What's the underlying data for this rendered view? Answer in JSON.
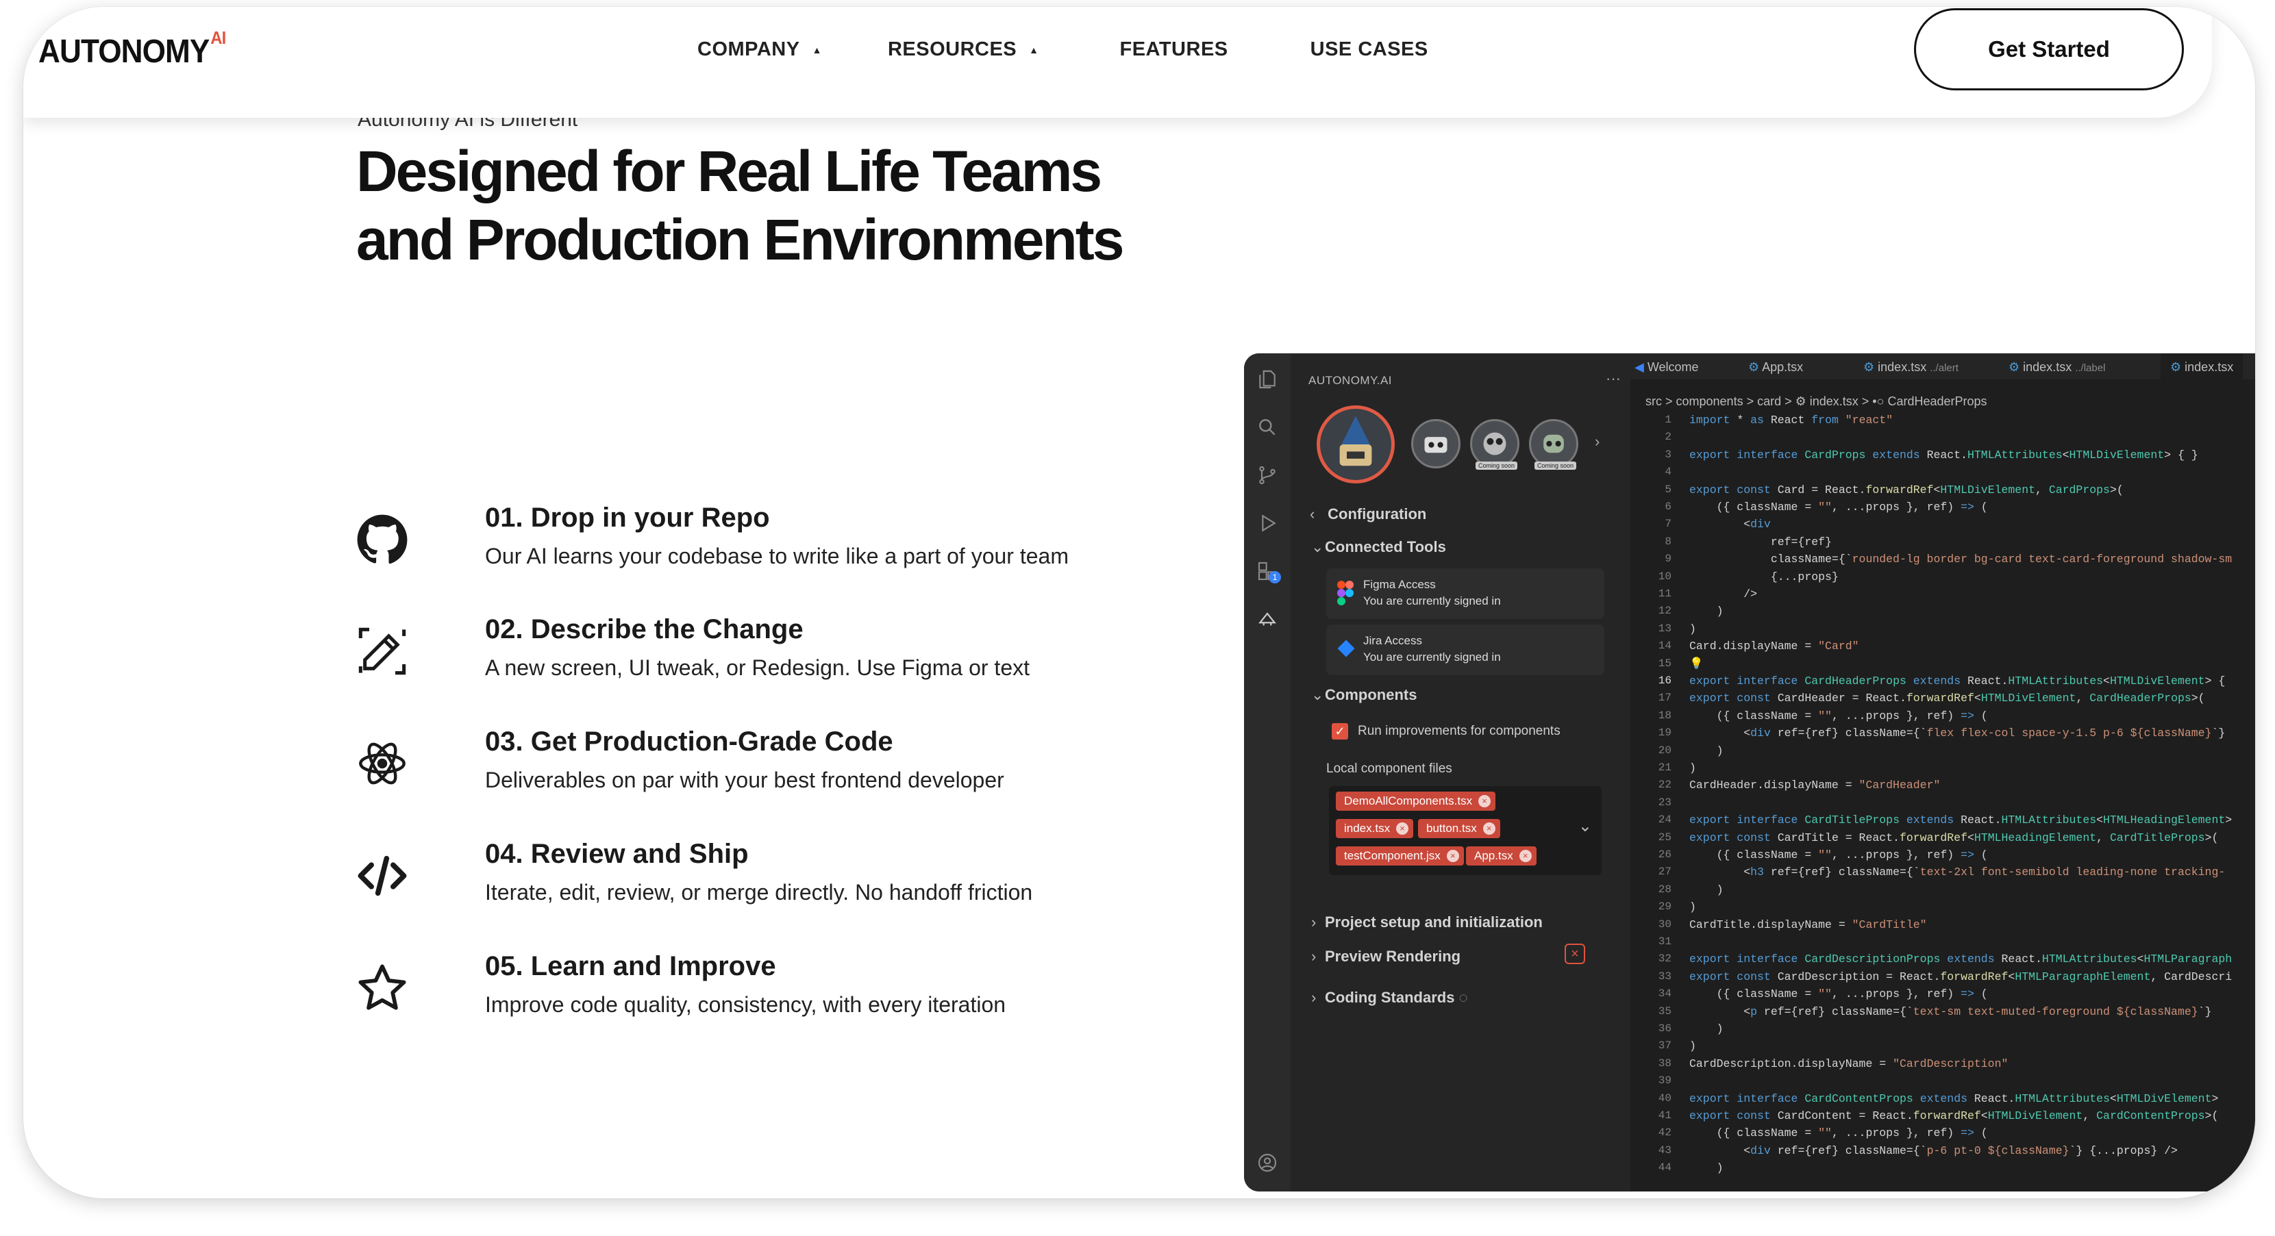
{
  "nav": {
    "logo_text": "AUTONOMY",
    "logo_sup": "AI",
    "items": [
      {
        "label": "COMPANY",
        "has_caret": true
      },
      {
        "label": "RESOURCES",
        "has_caret": true
      },
      {
        "label": "FEATURES",
        "has_caret": false
      },
      {
        "label": "USE CASES",
        "has_caret": false
      }
    ],
    "cta_label": "Get Started"
  },
  "hero": {
    "eyebrow": "Autonomy AI is Different",
    "headline_line1": "Designed for Real Life Teams",
    "headline_line2": "and Production Environments"
  },
  "steps": [
    {
      "title": "01. Drop in your Repo",
      "desc": "Our AI learns your codebase to write like a part of your team",
      "icon": "github-icon"
    },
    {
      "title": "02. Describe the Change",
      "desc": "A new screen, UI tweak, or Redesign. Use Figma or text",
      "icon": "pencil-icon"
    },
    {
      "title": "03. Get Production-Grade Code",
      "desc": "Deliverables on par with your best frontend developer",
      "icon": "atom-icon"
    },
    {
      "title": "04. Review and Ship",
      "desc": "Iterate, edit, review, or merge directly. No handoff friction",
      "icon": "code-icon"
    },
    {
      "title": "05. Learn and Improve",
      "desc": "Improve code quality, consistency, with every iteration",
      "icon": "star-icon"
    }
  ],
  "ide": {
    "panel_title": "AUTONOMY.AI",
    "avatar_badges": [
      "Coming soon",
      "Coming soon"
    ],
    "activity_badge": "1",
    "configuration": "Configuration",
    "connected_tools": "Connected Tools",
    "tools": [
      {
        "name": "Figma Access",
        "status": "You are currently signed in"
      },
      {
        "name": "Jira Access",
        "status": "You are currently signed in"
      }
    ],
    "components": "Components",
    "run_improvements": "Run improvements for components",
    "local_files_label": "Local component files",
    "files": [
      "DemoAllComponents.tsx",
      "index.tsx",
      "button.tsx",
      "testComponent.jsx",
      "App.tsx"
    ],
    "sections": [
      "Project setup and initialization",
      "Preview Rendering",
      "Coding Standards"
    ],
    "tabs": [
      "Welcome",
      "App.tsx",
      "index.tsx",
      "../alert",
      "index.tsx",
      "../label",
      "index.tsx"
    ],
    "breadcrumb": "src > components > card > ⚙ index.tsx > •○ CardHeaderProps",
    "line_numbers": [
      "1",
      "2",
      "3",
      "4",
      "5",
      "6",
      "7",
      "8",
      "9",
      "10",
      "11",
      "12",
      "13",
      "14",
      "15",
      "16",
      "17",
      "18",
      "19",
      "20",
      "21",
      "22",
      "23",
      "24",
      "25",
      "26",
      "27",
      "28",
      "29",
      "30",
      "31",
      "32",
      "33",
      "34",
      "35",
      "36",
      "37",
      "38",
      "39",
      "40",
      "41",
      "42",
      "43",
      "44"
    ]
  }
}
